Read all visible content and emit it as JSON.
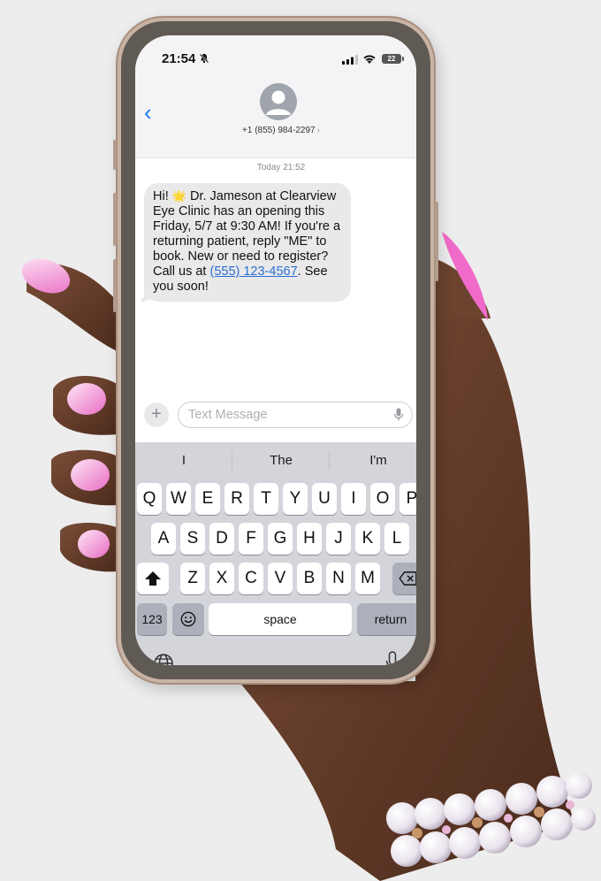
{
  "status_bar": {
    "time": "21:54",
    "battery_level": "22"
  },
  "conversation": {
    "contact_number": "+1 (855) 984-2297",
    "back_icon": "chevron-left-icon",
    "avatar_icon": "person-icon"
  },
  "messages": [
    {
      "timestamp": "Today 21:52",
      "text_before_emoji": "Hi!",
      "emoji": "🌟",
      "text_before_link": "Dr. Jameson at Clearview Eye Clinic has an opening this Friday, 5/7 at 9:30 AM! If you're a returning patient, reply \"ME\" to book. New or need to register? Call us at",
      "link_text": "(555) 123-4567",
      "text_after_link": ". See you soon!"
    }
  ],
  "input": {
    "placeholder": "Text Message",
    "plus_icon": "plus-icon",
    "mic_icon": "microphone-icon"
  },
  "keyboard": {
    "suggestions": [
      "I",
      "The",
      "I'm"
    ],
    "row1": [
      "Q",
      "W",
      "E",
      "R",
      "T",
      "Y",
      "U",
      "I",
      "O",
      "P"
    ],
    "row2": [
      "A",
      "S",
      "D",
      "F",
      "G",
      "H",
      "J",
      "K",
      "L"
    ],
    "row3": [
      "Z",
      "X",
      "C",
      "V",
      "B",
      "N",
      "M"
    ],
    "numbers_key": "123",
    "space_key": "space",
    "return_key": "return",
    "shift_icon": "shift-icon",
    "delete_icon": "delete-icon",
    "emoji_icon": "emoji-icon",
    "globe_icon": "globe-icon",
    "dictation_icon": "microphone-icon"
  },
  "colors": {
    "accent_blue": "#1a7cf5",
    "bubble_gray": "#e9e9eb",
    "keyboard_bg": "#d3d5da",
    "nail_pink": "#f29ad6"
  }
}
